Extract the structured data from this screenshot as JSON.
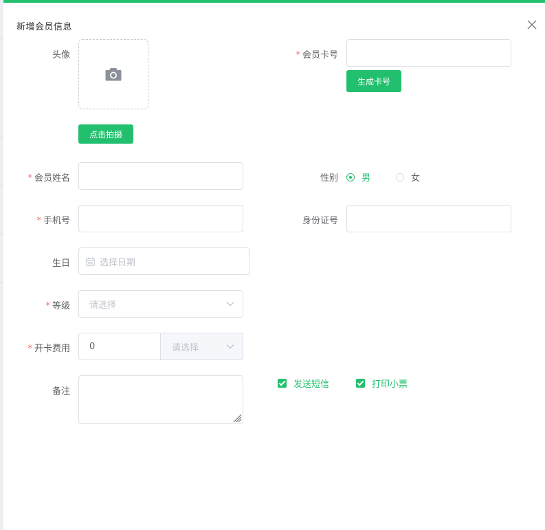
{
  "dialog": {
    "title": "新增会员信息",
    "accent_color": "#22c06e"
  },
  "form": {
    "avatar_label": "头像",
    "capture_button": "点击拍摄",
    "card_no_label": "会员卡号",
    "generate_card_button": "生成卡号",
    "name_label": "会员姓名",
    "gender_label": "性别",
    "gender_options": [
      "男",
      "女"
    ],
    "gender_selected": "男",
    "phone_label": "手机号",
    "id_card_label": "身份证号",
    "birthday_label": "生日",
    "birthday_placeholder": "选择日期",
    "level_label": "等级",
    "level_placeholder": "请选择",
    "fee_label": "开卡费用",
    "fee_value": "0",
    "fee_unit_placeholder": "请选择",
    "remark_label": "备注",
    "send_sms_label": "发送短信",
    "send_sms_checked": true,
    "print_receipt_label": "打印小票",
    "print_receipt_checked": true
  },
  "icons": {
    "close": "close-icon",
    "camera": "camera-icon",
    "calendar": "calendar-icon",
    "dropdown": "chevron-down-icon"
  }
}
